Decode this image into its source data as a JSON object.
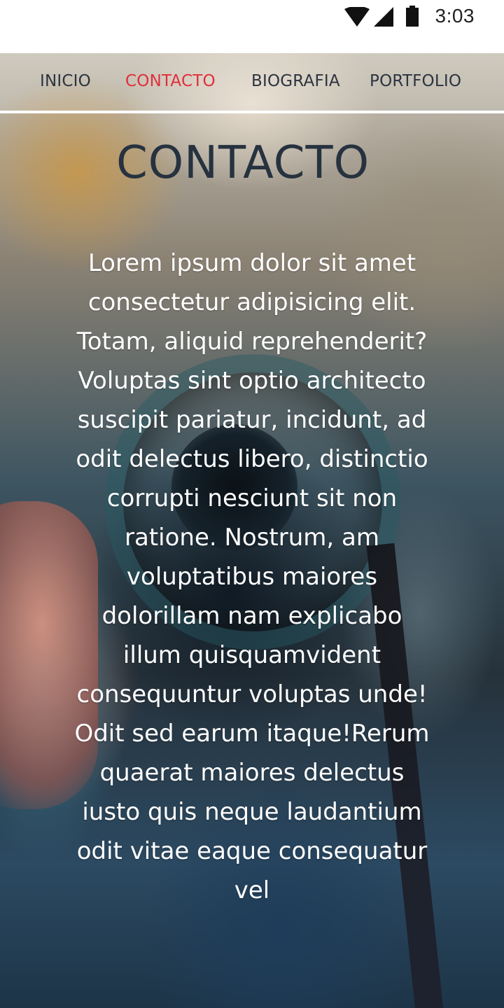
{
  "status_bar": {
    "time": "3:03",
    "icons": [
      "wifi-icon",
      "cellular-signal-icon",
      "battery-icon"
    ]
  },
  "nav": {
    "items": [
      {
        "label": "INICIO",
        "active": false
      },
      {
        "label": "CONTACTO",
        "active": true
      },
      {
        "label": "BIOGRAFIA",
        "active": false
      },
      {
        "label": "PORTFOLIO",
        "active": false
      }
    ]
  },
  "page": {
    "title": "CONTACTO",
    "body": "Lorem ipsum dolor sit amet consectetur adipisicing elit. Totam, aliquid reprehenderit? Voluptas sint optio architecto suscipit pariatur, incidunt, ad odit delectus libero, distinctio corrupti nesciunt sit non ratione. Nostrum, am voluptatibus maiores dolorillam nam explicabo illum quisquamvident consequuntur voluptas unde! Odit sed earum itaque!Rerum quaerat maiores delectus iusto quis neque laudantium odit vitae eaque consequatur vel"
  },
  "colors": {
    "nav_active": "#e0303c",
    "nav_text": "#2c3440",
    "title": "#26323f",
    "body_text": "#ffffff"
  }
}
